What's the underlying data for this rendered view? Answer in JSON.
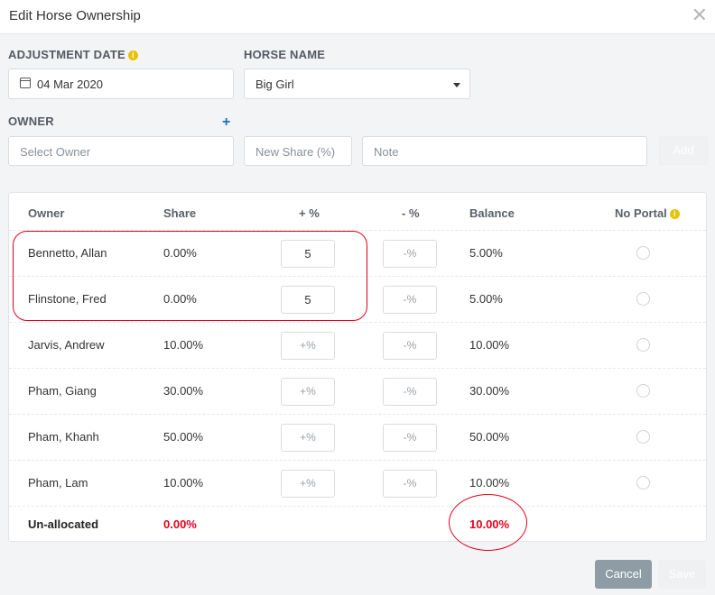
{
  "header": {
    "title": "Edit Horse Ownership",
    "close_glyph": "✕"
  },
  "form": {
    "adjustment_date_label": "ADJUSTMENT DATE",
    "adjustment_date_value": "04 Mar 2020",
    "horse_name_label": "HORSE NAME",
    "horse_name_value": "Big Girl",
    "owner_label": "OWNER",
    "owner_placeholder": "Select Owner",
    "share_placeholder": "New Share (%)",
    "note_placeholder": "Note",
    "add_label": "Add"
  },
  "table": {
    "headers": [
      "Owner",
      "Share",
      "+ %",
      "- %",
      "Balance",
      "No Portal"
    ],
    "rows": [
      {
        "owner": "Bennetto, Allan",
        "share": "0.00%",
        "plus": "5",
        "minus": "-%",
        "balance": "5.00%"
      },
      {
        "owner": "Flinstone, Fred",
        "share": "0.00%",
        "plus": "5",
        "minus": "-%",
        "balance": "5.00%"
      },
      {
        "owner": "Jarvis, Andrew",
        "share": "10.00%",
        "plus": "+%",
        "minus": "-%",
        "balance": "10.00%"
      },
      {
        "owner": "Pham, Giang",
        "share": "30.00%",
        "plus": "+%",
        "minus": "-%",
        "balance": "30.00%"
      },
      {
        "owner": "Pham, Khanh",
        "share": "50.00%",
        "plus": "+%",
        "minus": "-%",
        "balance": "50.00%"
      },
      {
        "owner": "Pham, Lam",
        "share": "10.00%",
        "plus": "+%",
        "minus": "-%",
        "balance": "10.00%"
      }
    ],
    "unallocated": {
      "label": "Un-allocated",
      "share": "0.00%",
      "balance": "10.00%"
    }
  },
  "footer": {
    "cancel_label": "Cancel",
    "save_label": "Save"
  },
  "colors": {
    "accent_blue": "#1d73b8",
    "warning_red": "#e8001c",
    "info_yellow": "#e9c100",
    "cancel_gray": "#8e9ca6"
  }
}
